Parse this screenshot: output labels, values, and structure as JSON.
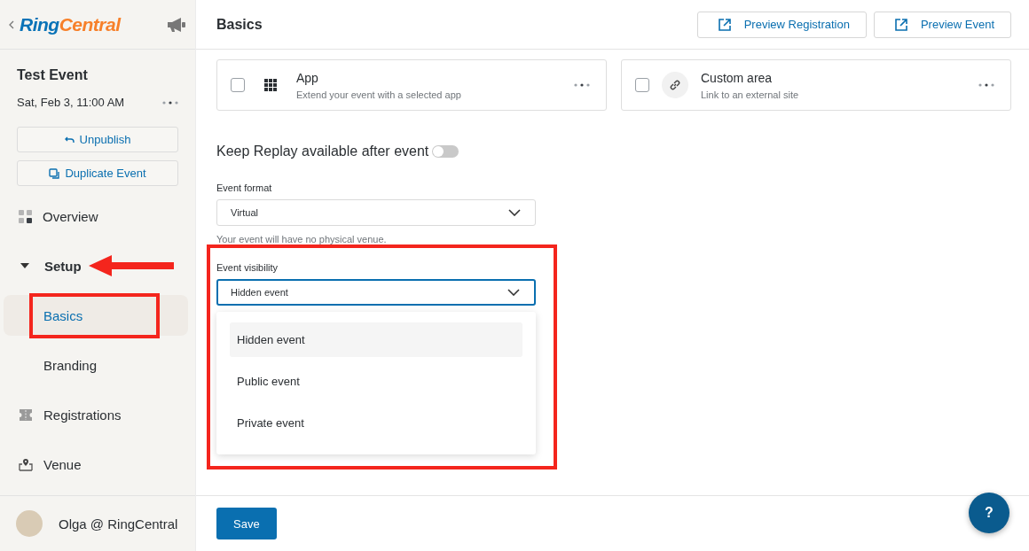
{
  "sidebar": {
    "logo": [
      "Ring",
      "Central"
    ],
    "event": {
      "title": "Test Event",
      "date": "Sat, Feb 3, 11:00 AM"
    },
    "actions": [
      {
        "label": "Unpublish",
        "kind": "undo"
      },
      {
        "label": "Duplicate Event",
        "kind": "copy"
      }
    ],
    "nav": [
      {
        "label": "Overview",
        "kind": "overview",
        "selected": false,
        "pointed": false,
        "highlighted": false
      },
      {
        "label": "Setup",
        "kind": "group",
        "selected": false,
        "expanded": true,
        "pointed": true,
        "highlighted": false,
        "children": [
          {
            "label": "Basics",
            "selected": true,
            "highlighted": true
          },
          {
            "label": "Branding",
            "selected": false,
            "highlighted": false
          }
        ]
      },
      {
        "label": "Registrations",
        "kind": "registrations",
        "selected": false,
        "pointed": false,
        "highlighted": false
      },
      {
        "label": "Venue",
        "kind": "venue",
        "selected": false,
        "pointed": false,
        "highlighted": false
      }
    ],
    "user": {
      "name": "Olga @ RingCentral"
    }
  },
  "main": {
    "title": "Basics",
    "header_buttons": [
      "Preview Registration",
      "Preview Event"
    ],
    "cards": [
      {
        "kind": "app",
        "title": "App",
        "subtitle": "Extend your event with a selected app",
        "checked": false
      },
      {
        "kind": "link",
        "title": "Custom area",
        "subtitle": "Link to an external site",
        "checked": false
      }
    ],
    "replay": {
      "label": "Keep Replay available after event",
      "on": false
    },
    "fields": [
      {
        "label": "Event format",
        "value": "Virtual",
        "helper": "Your event will have no physical venue.",
        "open": false,
        "highlighted": false
      },
      {
        "label": "Event visibility",
        "value": "Hidden event",
        "open": true,
        "highlighted": true,
        "options": [
          {
            "label": "Hidden event",
            "selected": true
          },
          {
            "label": "Public event",
            "selected": false
          },
          {
            "label": "Private event",
            "selected": false
          }
        ]
      }
    ],
    "save": "Save",
    "help": "?"
  }
}
